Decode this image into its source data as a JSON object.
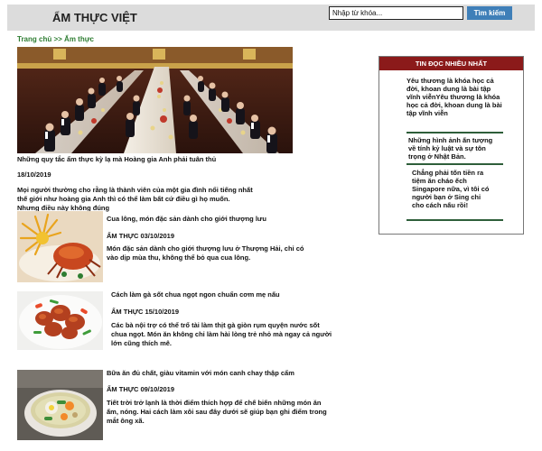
{
  "header": {
    "site_title": "ẨM THỰC VIỆT",
    "search_placeholder": "Nhập từ khóa...",
    "search_button": "Tìm kiếm"
  },
  "breadcrumb": {
    "home": "Trang chủ",
    "separator": ">>",
    "current": "Ẩm thực"
  },
  "featured": {
    "caption": "Những quy tắc ẩm thực kỳ lạ mà Hoàng gia Anh phải tuân thủ",
    "date": "18/10/2019",
    "summary": "Mọi người thường cho rằng là thành viên của một gia đình nổi tiếng nhất thế giới như hoàng gia Anh thì có thể làm bất cứ điều gì họ muốn. Nhưng điều này không đúng"
  },
  "articles": [
    {
      "title": "Cua lông, món đặc sản dành cho giới thượng lưu",
      "meta": "ẨM THỰC 03/10/2019",
      "summary": "Món đặc sản dành cho giới thượng lưu ở Thượng Hải, chỉ có vào dịp mùa thu, không thể bỏ qua cua lông."
    },
    {
      "title": "Cách làm gà sốt chua ngọt ngon chuẩn cơm mẹ nấu",
      "meta": "ẨM THỰC 15/10/2019",
      "summary": "Các bà nội trợ có thể trổ tài làm thịt gà giòn rụm quyện nước sốt chua ngọt. Món ăn không chỉ làm hài lòng trẻ nhỏ mà ngay cả người lớn cũng thích mê."
    },
    {
      "title": "Bữa ăn đủ chất, giàu vitamin với món canh chay thập cẩm",
      "meta": "ẨM THỰC 09/10/2019",
      "summary": "Tiết trời trở lạnh là thời điểm thích hợp để chế biến những món ăn ấm, nóng. Hai cách làm xôi sau đây dưới sẽ giúp bạn ghi điểm trong mắt ông xã."
    }
  ],
  "sidebar": {
    "title": "TIN ĐỌC NHIỀU NHẤT",
    "items": [
      "Yêu thương là khóa học cả đời, khoan dung là bài tập vĩnh viễnYêu thương là khóa học cả đời, khoan dung là bài tập vĩnh viễn",
      "Những hình ảnh ấn tượng về tính kỷ luật và sự tôn trọng ở Nhật Bản.",
      "Chẳng phải tốn tiền ra tiệm ăn cháo ếch Singapore nữa, vì tôi có người bạn ở Sing chỉ cho cách nấu rồi!"
    ]
  },
  "colors": {
    "header_bg": "#dcdcdc",
    "search_button": "#3f7fb8",
    "breadcrumb": "#2e7d32",
    "sidebar_header": "#8b1a1a",
    "sidebar_divider": "#2e5e3a"
  }
}
